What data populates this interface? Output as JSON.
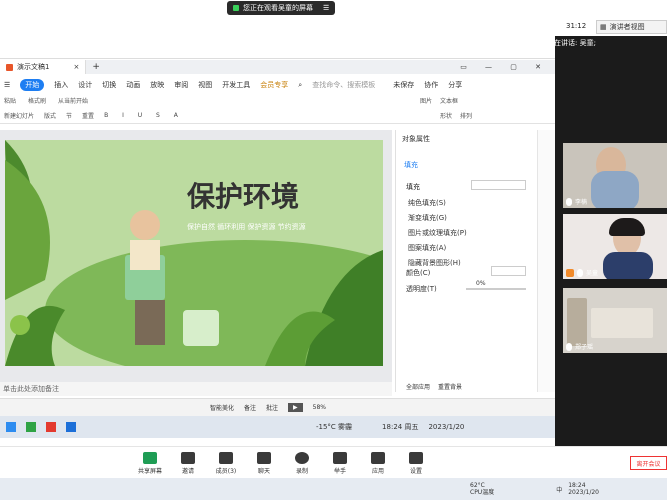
{
  "banner": {
    "text": "您正在观看吴童的屏幕",
    "timer": "31:12",
    "view_label": "演讲者视图"
  },
  "speaker": {
    "label": "正在讲话: 吴童;"
  },
  "wps": {
    "doc_tab": "演示文稿1",
    "menu": [
      "开始",
      "插入",
      "设计",
      "切换",
      "动画",
      "放映",
      "审阅",
      "视图",
      "开发工具",
      "会员专享"
    ],
    "search_placeholder": "查找命令、搜索模板",
    "actions": {
      "save": "未保存",
      "collab": "协作",
      "share": "分享"
    },
    "toolbar": [
      "粘贴",
      "格式刷",
      "从当前开始",
      "新建幻灯片",
      "版式",
      "节",
      "重置",
      "图片",
      "形状",
      "排列",
      "文本框"
    ],
    "panel": {
      "title": "对象属性",
      "tab": "填充",
      "section": "填充",
      "options": [
        "纯色填充(S)",
        "渐变填充(G)",
        "图片或纹理填充(P)",
        "图案填充(A)",
        "隐藏背景图形(H)"
      ],
      "color_label": "颜色(C)",
      "transparency_label": "透明度(T)",
      "transparency_value": "0%",
      "apply_all": "全部应用",
      "reset_bg": "重置背景"
    },
    "slide": {
      "title": "保护环境",
      "subtitle": "保护自然 循环利用 保护资源 节约资源",
      "color": "#5aa82e"
    },
    "notes": "单击此处添加备注",
    "status": {
      "beautify": "智能美化",
      "notes": "备注",
      "comments": "批注",
      "zoom": "58%"
    }
  },
  "taskbar": {
    "weather": "-15°C 雾霾",
    "time": "18:24 周五",
    "date": "2023/1/20"
  },
  "meeting": {
    "buttons": [
      "共享屏幕",
      "邀请",
      "成员(3)",
      "聊天",
      "录制",
      "举手",
      "应用",
      "设置"
    ],
    "leave": "离开会议"
  },
  "sys": {
    "temp": "62°C",
    "cpu": "CPU温度",
    "ime": "中",
    "time": "18:24",
    "date": "2023/1/20"
  },
  "participants": [
    {
      "name": "李楠"
    },
    {
      "name": "吴童"
    },
    {
      "name": "郑子瑶"
    }
  ]
}
